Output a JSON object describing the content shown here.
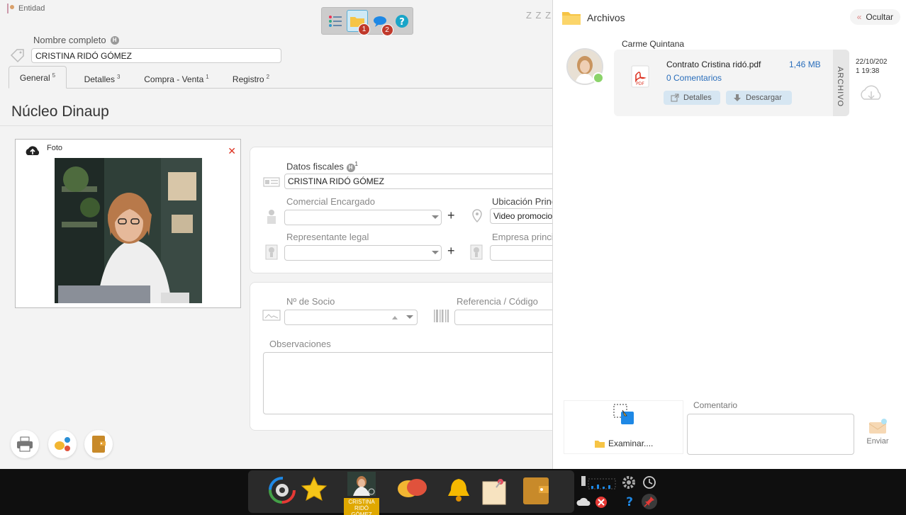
{
  "entity": {
    "label": "Entidad"
  },
  "top_toolbar": {
    "files_badge": "1",
    "comments_badge": "2"
  },
  "sleep_text": "Z Z Z",
  "nombre": {
    "label": "Nombre completo",
    "value": "CRISTINA RIDÓ GÓMEZ"
  },
  "tabs": [
    {
      "label": "General",
      "count": "5"
    },
    {
      "label": "Detalles",
      "count": "3"
    },
    {
      "label": "Compra - Venta",
      "count": "1"
    },
    {
      "label": "Registro",
      "count": "2"
    }
  ],
  "section_title": "Núcleo Dinaup",
  "photo": {
    "label": "Foto"
  },
  "fields": {
    "datos_fiscales": {
      "label": "Datos fiscales",
      "badge": "1",
      "value": "CRISTINA RIDÓ GÓMEZ"
    },
    "comercial": {
      "label": "Comercial Encargado",
      "value": ""
    },
    "ubicacion": {
      "label": "Ubicación Princ",
      "value": "Video promocio"
    },
    "representante": {
      "label": "Representante legal",
      "value": ""
    },
    "empresa": {
      "label": "Empresa princi",
      "value": ""
    },
    "socio": {
      "label": "Nº de Socio",
      "value": ""
    },
    "referencia": {
      "label": "Referencia / Código",
      "value": ""
    },
    "observaciones": {
      "label": "Observaciones",
      "value": ""
    }
  },
  "files_panel": {
    "title": "Archivos",
    "hide_label": "Ocultar",
    "owner": "Carme Quintana",
    "file": {
      "name": "Contrato Cristina ridó.pdf",
      "size": "1,46 MB",
      "comments": "0 Comentarios",
      "details_label": "Detalles",
      "download_label": "Descargar",
      "side_label": "ARCHIVO",
      "date_line1": "22/10/202",
      "date_line2": "1 19:38"
    },
    "browse_label": "Examinar....",
    "comment_label": "Comentario",
    "send_label": "Enviar"
  },
  "taskbar": {
    "user_line1": "CRISTINA",
    "user_line2": "RIDÓ GÓMEZ"
  },
  "colors": {
    "accent_blue": "#2a6ebb",
    "badge_red": "#c0392b",
    "online_green": "#8bd36a"
  }
}
